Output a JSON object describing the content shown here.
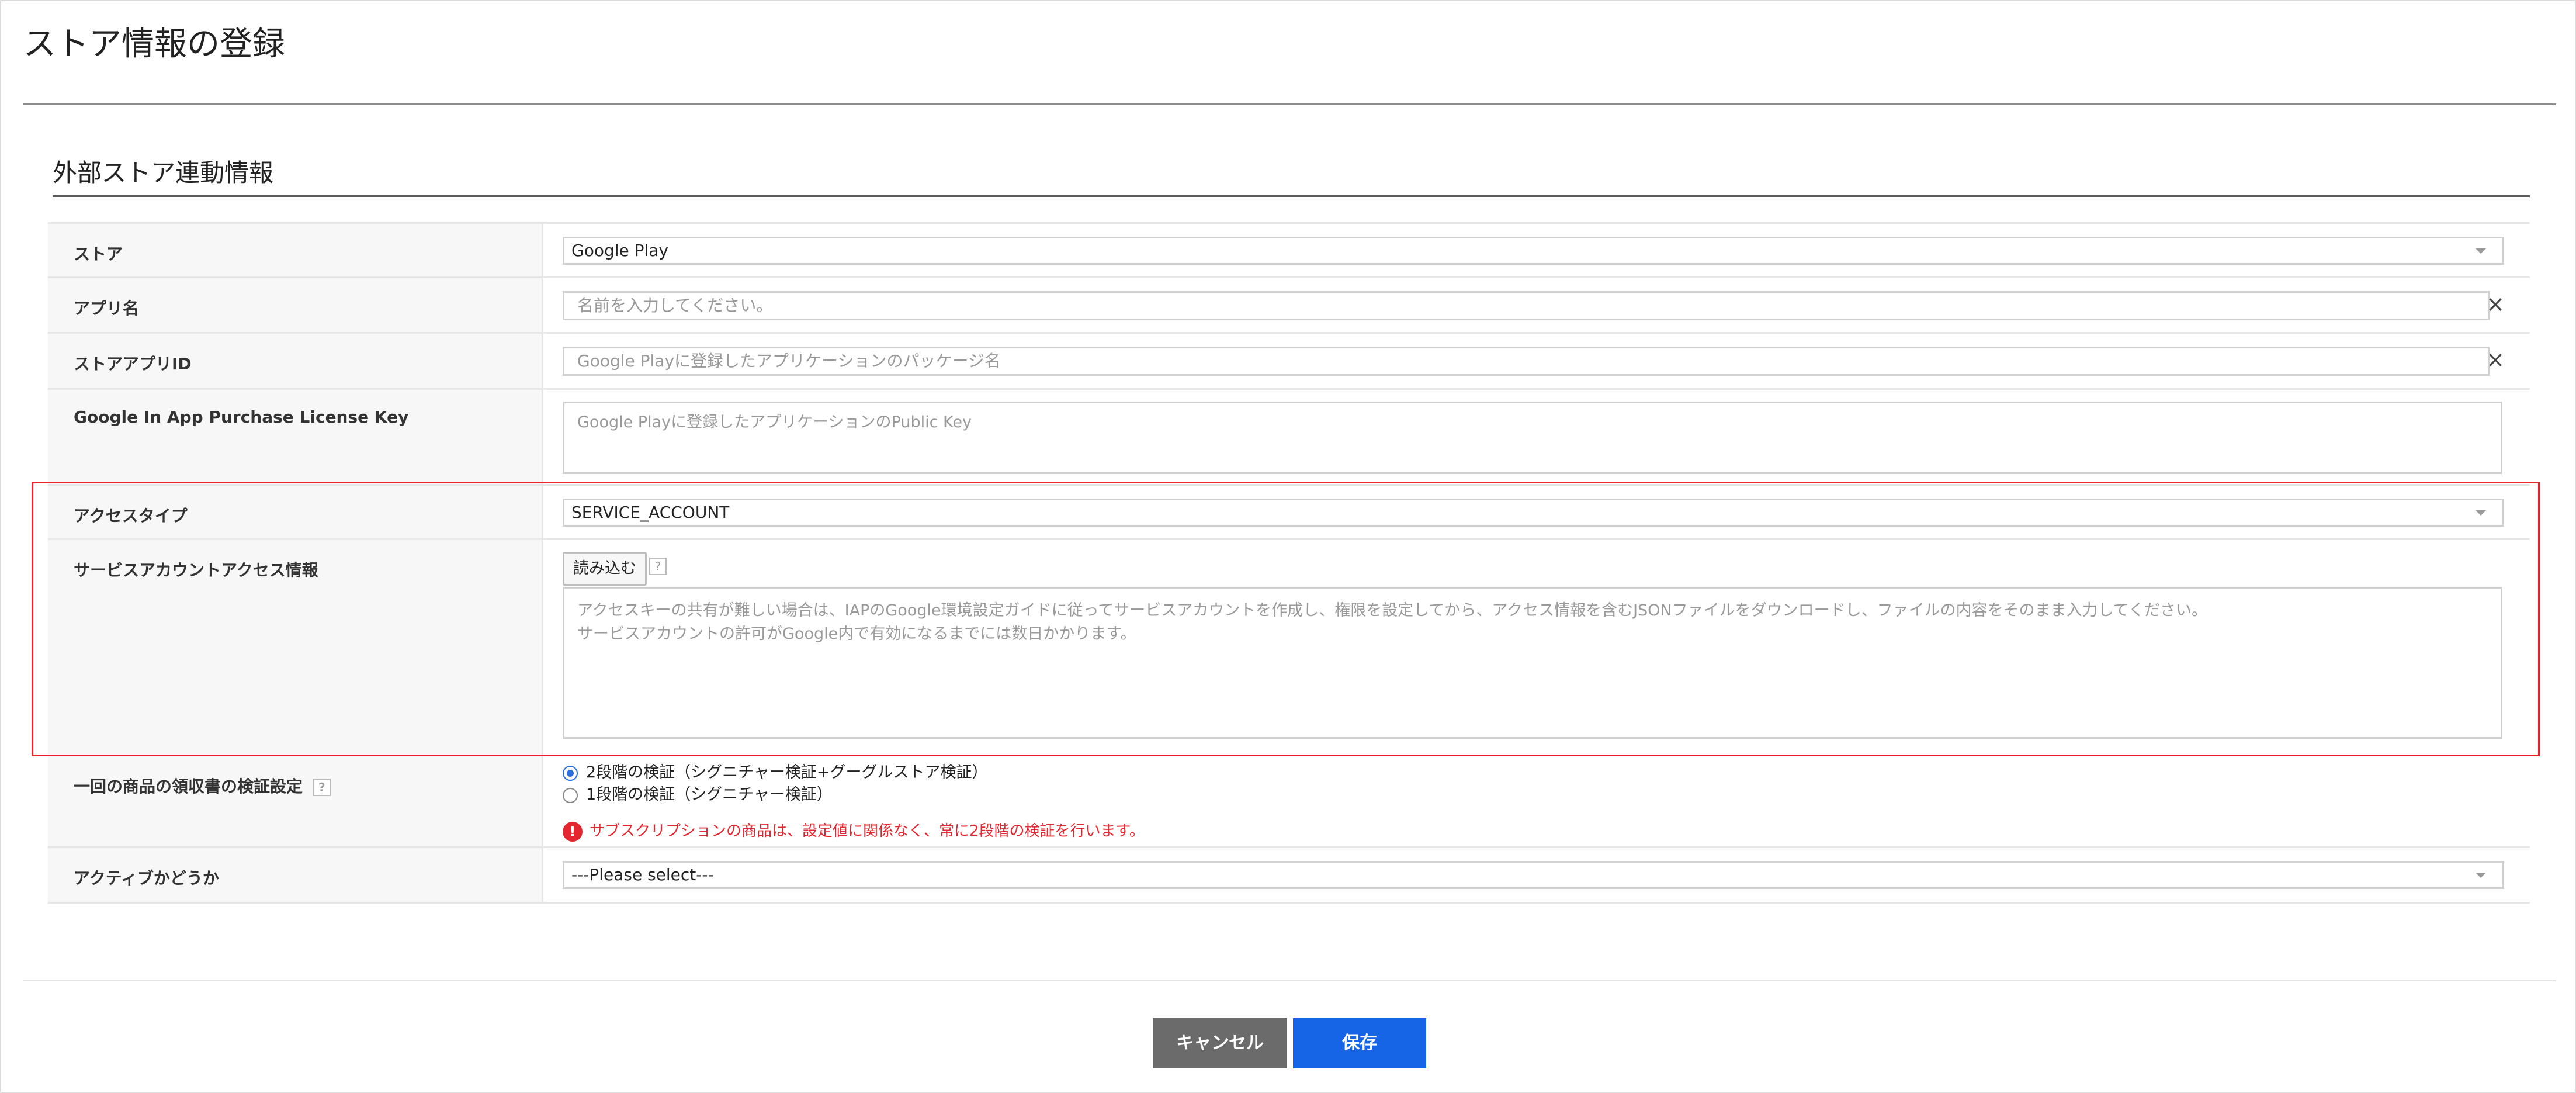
{
  "page": {
    "title": "ストア情報の登録"
  },
  "section": {
    "title": "外部ストア連動情報"
  },
  "fields": {
    "store": {
      "label": "ストア",
      "value": "Google Play"
    },
    "app_name": {
      "label": "アプリ名",
      "placeholder": "名前を入力してください。"
    },
    "store_app_id": {
      "label": "ストアアプリID",
      "placeholder": "Google Playに登録したアプリケーションのパッケージ名"
    },
    "license_key": {
      "label": "Google In App Purchase License Key",
      "placeholder": "Google Playに登録したアプリケーションのPublic Key"
    },
    "access_type": {
      "label": "アクセスタイプ",
      "value": "SERVICE_ACCOUNT"
    },
    "service_account": {
      "label": "サービスアカウントアクセス情報",
      "load_button": "読み込む",
      "placeholder_line1": "アクセスキーの共有が難しい場合は、IAPのGoogle環境設定ガイドに従ってサービスアカウントを作成し、権限を設定してから、アクセス情報を含むJSONファイルをダウンロードし、ファイルの内容をそのまま入力してください。",
      "placeholder_line2": "サービスアカウントの許可がGoogle内で有効になるまでには数日かかります。"
    },
    "receipt_verification": {
      "label": "一回の商品の領収書の検証設定",
      "options": [
        {
          "label": "2段階の検証（シグニチャー検証+グーグルストア検証）",
          "checked": true
        },
        {
          "label": "1段階の検証（シグニチャー検証）",
          "checked": false
        }
      ],
      "warning": "サブスクリプションの商品は、設定値に関係なく、常に2段階の検証を行います。"
    },
    "active": {
      "label": "アクティブかどうか",
      "value": "---Please select---"
    }
  },
  "buttons": {
    "cancel": "キャンセル",
    "save": "保存"
  },
  "icons": {
    "help": "?",
    "clear": "×",
    "warning": "!"
  },
  "colors": {
    "highlight": "#e3262f",
    "save_button": "#1565e6",
    "cancel_button": "#6b6b6b",
    "warning_text": "#e3262f"
  }
}
